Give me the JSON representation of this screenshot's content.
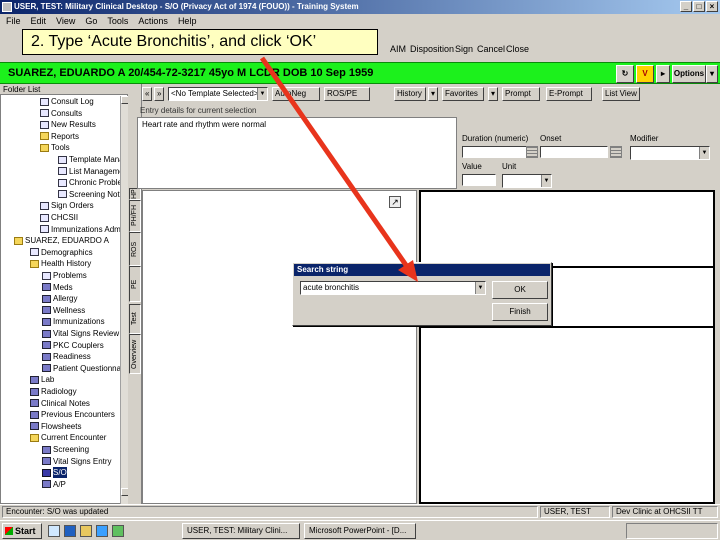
{
  "window": {
    "title": "USER, TEST: Military Clinical Desktop - S/O (Privacy Act of 1974 (FOUO)) - Training System"
  },
  "menu": [
    "File",
    "Edit",
    "View",
    "Go",
    "Tools",
    "Actions",
    "Help"
  ],
  "toolbar": {
    "items": [
      "AIM",
      "Disposition",
      "Sign",
      "Cancel",
      "Close"
    ]
  },
  "callout": {
    "text": "2. Type ‘Acute Bronchitis’, and click ‘OK’"
  },
  "patient": {
    "banner": "SUAREZ, EDUARDO A 20/454-72-3217 45yo M LCDR DOB 10 Sep 1959",
    "options_label": "Options"
  },
  "folder_list": {
    "header": "Folder List",
    "items": [
      {
        "label": "Consult Log",
        "icon": "doc-icon"
      },
      {
        "label": "Consults",
        "icon": "doc-icon"
      },
      {
        "label": "New Results",
        "icon": "doc-icon"
      },
      {
        "label": "Reports",
        "icon": "folder-icon"
      },
      {
        "label": "Tools",
        "icon": "folder-icon"
      },
      {
        "label": "Template Manager",
        "icon": "doc-icon"
      },
      {
        "label": "List Management",
        "icon": "doc-icon"
      },
      {
        "label": "Chronic Problems",
        "icon": "doc-icon"
      },
      {
        "label": "Screening Notifications",
        "icon": "doc-icon"
      },
      {
        "label": "Sign Orders",
        "icon": "doc-icon"
      },
      {
        "label": "CHCSII",
        "icon": "doc-icon"
      },
      {
        "label": "Immunizations Admin",
        "icon": "doc-icon"
      },
      {
        "label": "SUAREZ, EDUARDO A",
        "icon": "folder-icon"
      },
      {
        "label": "Demographics",
        "icon": "doc-icon"
      },
      {
        "label": "Health History",
        "icon": "folder-icon"
      },
      {
        "label": "Problems",
        "icon": "doc-icon"
      },
      {
        "label": "Meds",
        "icon": "pic-icon"
      },
      {
        "label": "Allergy",
        "icon": "pic-icon"
      },
      {
        "label": "Wellness",
        "icon": "pic-icon"
      },
      {
        "label": "Immunizations",
        "icon": "pic-icon"
      },
      {
        "label": "Vital Signs Review",
        "icon": "pic-icon"
      },
      {
        "label": "PKC Couplers",
        "icon": "pic-icon"
      },
      {
        "label": "Readiness",
        "icon": "pic-icon"
      },
      {
        "label": "Patient Questionnaire",
        "icon": "pic-icon"
      },
      {
        "label": "Lab",
        "icon": "pic-icon"
      },
      {
        "label": "Radiology",
        "icon": "pic-icon"
      },
      {
        "label": "Clinical Notes",
        "icon": "pic-icon"
      },
      {
        "label": "Previous Encounters",
        "icon": "pic-icon"
      },
      {
        "label": "Flowsheets",
        "icon": "pic-icon"
      },
      {
        "label": "Current Encounter",
        "icon": "folder-icon"
      },
      {
        "label": "Screening",
        "icon": "pic-icon"
      },
      {
        "label": "Vital Signs Entry",
        "icon": "pic-icon"
      },
      {
        "label": "S/O",
        "icon": "flag-icon"
      },
      {
        "label": "A/P",
        "icon": "pic-icon"
      }
    ]
  },
  "vtabs": [
    "PE",
    "ROS",
    "PH/FH",
    "HPI",
    "Test",
    "Overview"
  ],
  "so_toolbar": {
    "template_select": "<No Template Selected>",
    "autoneg": "AutoNeg",
    "ros_pe": "ROS/PE",
    "history": "History",
    "favorites": "Favorites",
    "prompt": "Prompt",
    "e_prompt": "E-Prompt",
    "listview": "List View"
  },
  "entry": {
    "hint": "Entry details for current selection",
    "text": "Heart rate and rhythm were normal",
    "duration_label": "Duration (numeric)",
    "onset_label": "Onset",
    "modifier_label": "Modifier",
    "value_label": "Value",
    "unit_label": "Unit"
  },
  "search_dialog": {
    "title": "Search string",
    "value": "acute bronchitis",
    "ok_label": "OK",
    "finish_label": "Finish"
  },
  "status": {
    "left": "Encounter: S/O was updated",
    "user": "USER, TEST",
    "clinic": "Dev Clinic at OHCSII TT"
  },
  "taskbar": {
    "start_label": "Start",
    "items": [
      "USER, TEST: Military Clini...",
      "Microsoft PowerPoint - [D..."
    ]
  },
  "colors": {
    "patient_bar": "#1cf11c",
    "arrow": "#e8341c",
    "title_bar": "#0a246a"
  }
}
